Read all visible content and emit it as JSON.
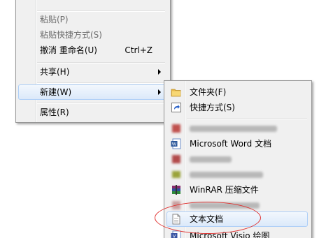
{
  "menu": {
    "items": [
      {
        "label": "粘贴(P)"
      },
      {
        "label": "粘贴快捷方式(S)"
      },
      {
        "label": "撤消 重命名(U)",
        "accel": "Ctrl+Z"
      },
      {
        "label": "共享(H)"
      },
      {
        "label": "新建(W)"
      },
      {
        "label": "属性(R)"
      }
    ]
  },
  "submenu": {
    "items": [
      {
        "label": "文件夹(F)",
        "icon": "folder-icon"
      },
      {
        "label": "快捷方式(S)",
        "icon": "shortcut-icon"
      },
      {
        "label": "Microsoft Word 文档",
        "icon": "word-icon"
      },
      {
        "label": "WinRAR 压缩文件",
        "icon": "winrar-icon"
      },
      {
        "label": "文本文档",
        "icon": "text-document-icon"
      },
      {
        "label": "Microsoft Visio 绘图",
        "icon": "visio-icon"
      }
    ]
  },
  "colors": {
    "menu_bg": "#f0f0f0",
    "highlight_border": "#aecff7",
    "annotation": "#e0312f"
  }
}
